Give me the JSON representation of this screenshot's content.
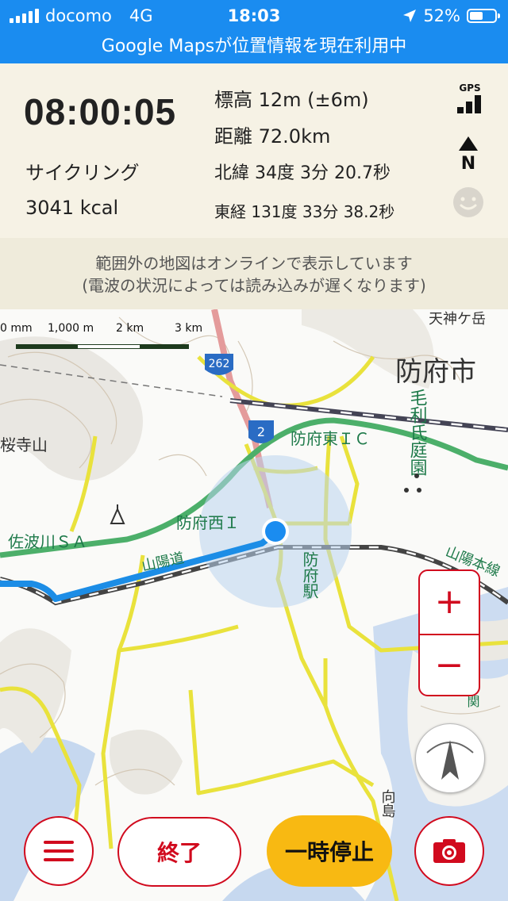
{
  "status_bar": {
    "carrier": "docomo",
    "network": "4G",
    "time": "18:03",
    "battery": "52%",
    "battery_level": 0.52
  },
  "banner": "Google Mapsが位置情報を現在利用中",
  "stats": {
    "elapsed": "08:00:05",
    "activity": "サイクリング",
    "calories": "3041 kcal",
    "altitude": "標高 12m (±6m)",
    "distance": "距離 72.0km",
    "latitude": "北緯 34度 3分 20.7秒",
    "longitude": "東経 131度 33分 38.2秒",
    "gps_label": "GPS",
    "north_label": "N"
  },
  "notice": {
    "line1": "範囲外の地図はオンラインで表示しています",
    "line2": "(電波の状況によっては読み込みが遅くなります)"
  },
  "map": {
    "scale_labels": [
      "0 mm",
      "1,000 m",
      "2 km",
      "3 km"
    ],
    "labels": {
      "city": "防府市",
      "garden": "毛利氏庭園",
      "ic_east": "防府東ＩＣ",
      "ic_west": "防府西Ｉ",
      "mountain": "桜寺山",
      "sa": "佐波川ＳＡ",
      "expressway": "山陽道",
      "station": "防府駅",
      "route_262": "262",
      "route_2": "2",
      "shinkansen": "山陽本線",
      "top_right": "天神ケ岳",
      "island": "向島",
      "kansai": "中関"
    },
    "colors": {
      "route": "#1c8de6",
      "location": "#1a8cf0",
      "expressway": "#4caf6a",
      "road": "#e8e040",
      "national_road": "#e8a0a0"
    }
  },
  "controls": {
    "zoom_in": "+",
    "zoom_out": "−",
    "end_label": "終了",
    "pause_label": "一時停止"
  },
  "theme": {
    "accent": "#d10a1e",
    "header": "#1a8cf0",
    "pause": "#f8b912"
  }
}
